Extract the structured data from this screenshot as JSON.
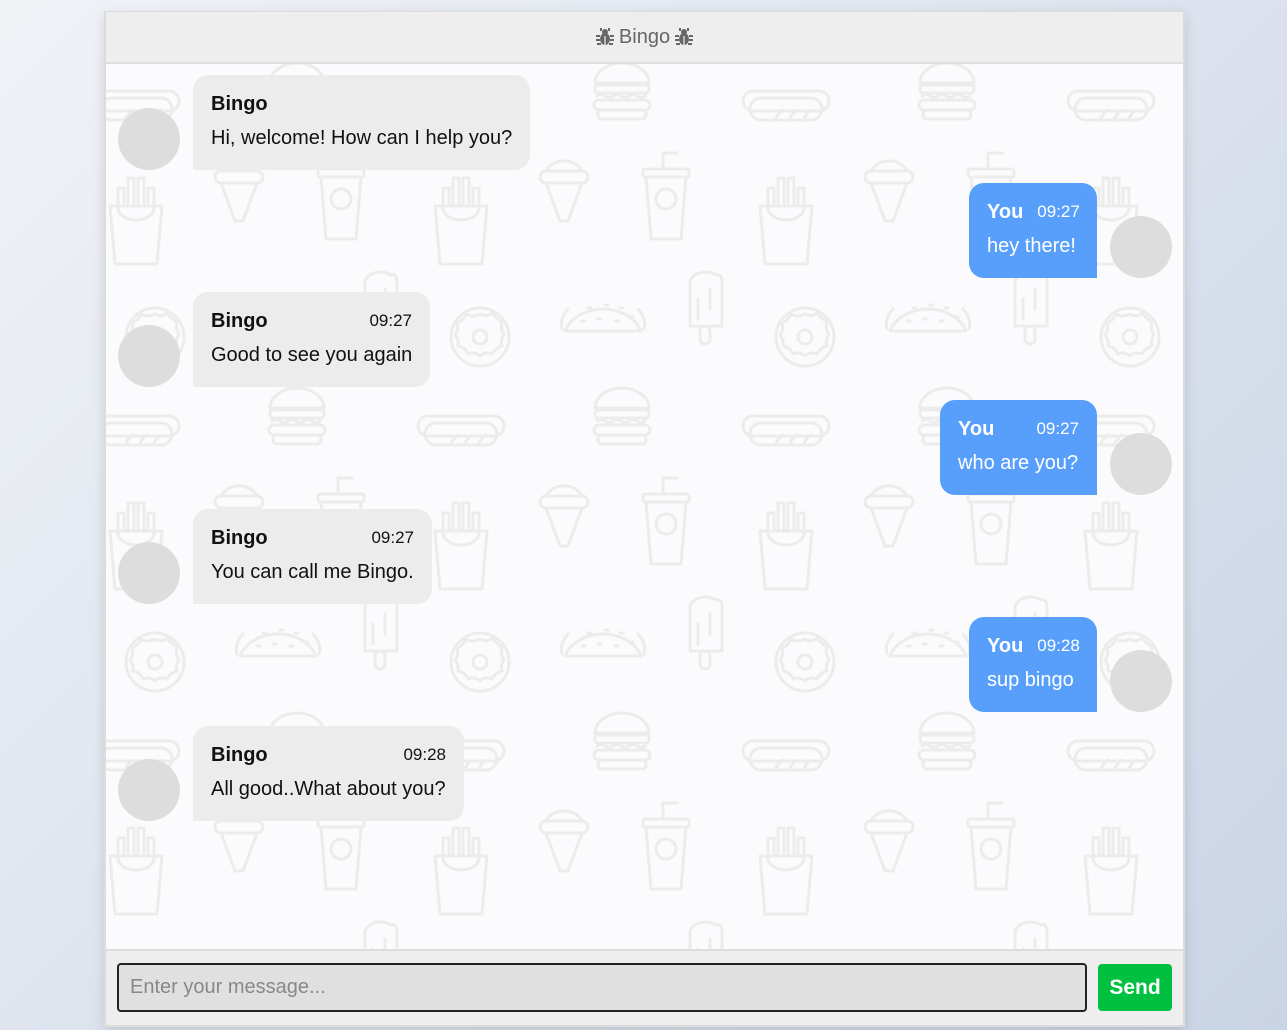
{
  "header": {
    "title": "Bingo",
    "left_icon": "bug-icon",
    "right_icon": "bug-icon"
  },
  "messages": [
    {
      "sender": "Bingo",
      "side": "bot",
      "time": "",
      "text": "Hi, welcome! How can I help you?"
    },
    {
      "sender": "You",
      "side": "user",
      "time": "09:27",
      "text": "hey there!"
    },
    {
      "sender": "Bingo",
      "side": "bot",
      "time": "09:27",
      "text": "Good to see you again"
    },
    {
      "sender": "You",
      "side": "user",
      "time": "09:27",
      "text": "who are you?"
    },
    {
      "sender": "Bingo",
      "side": "bot",
      "time": "09:27",
      "text": "You can call me Bingo."
    },
    {
      "sender": "You",
      "side": "user",
      "time": "09:28",
      "text": "sup bingo"
    },
    {
      "sender": "Bingo",
      "side": "bot",
      "time": "09:28",
      "text": "All good..What about you?"
    }
  ],
  "input": {
    "value": "",
    "placeholder": "Enter your message..."
  },
  "send_button": {
    "label": "Send"
  },
  "colors": {
    "user_bubble": "#579ffb",
    "bot_bubble": "#ececec",
    "send_button": "#00c13f",
    "avatar": "#dddddd"
  },
  "background_pattern_icons": [
    "hotdog-icon",
    "burger-icon",
    "fries-icon",
    "ice-cream-icon",
    "soda-cup-icon",
    "donut-icon",
    "taco-icon",
    "popsicle-icon"
  ]
}
